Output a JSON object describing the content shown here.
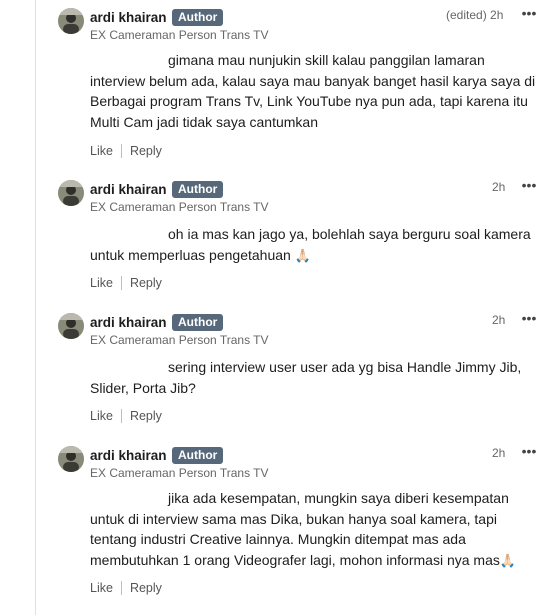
{
  "comments": [
    {
      "author": "ardi khairan",
      "badge": "Author",
      "subtitle": "EX Cameraman Person Trans TV",
      "time": "(edited) 2h",
      "text": "gimana mau nunjukin skill kalau panggilan lamaran interview belum ada, kalau saya mau banyak banget hasil karya saya di Berbagai program Trans Tv, Link YouTube nya pun ada, tapi karena itu Multi Cam jadi tidak saya cantumkan",
      "like": "Like",
      "reply": "Reply"
    },
    {
      "author": "ardi khairan",
      "badge": "Author",
      "subtitle": "EX Cameraman Person Trans TV",
      "time": "2h",
      "text": "oh ia mas kan jago ya, bolehlah saya berguru soal kamera untuk memperluas pengetahuan",
      "emoji": "🙏🏻",
      "like": "Like",
      "reply": "Reply"
    },
    {
      "author": "ardi khairan",
      "badge": "Author",
      "subtitle": "EX Cameraman Person Trans TV",
      "time": "2h",
      "text": "sering interview user user ada yg bisa Handle Jimmy Jib, Slider, Porta Jib?",
      "like": "Like",
      "reply": "Reply"
    },
    {
      "author": "ardi khairan",
      "badge": "Author",
      "subtitle": "EX Cameraman Person Trans TV",
      "time": "2h",
      "text": "jika ada kesempatan, mungkin saya diberi kesempatan untuk di interview sama mas Dika, bukan hanya soal kamera, tapi tentang industri Creative lainnya. Mungkin ditempat mas ada membutuhkan 1 orang Videografer lagi, mohon informasi nya mas",
      "emoji": "🙏🏻",
      "like": "Like",
      "reply": "Reply"
    }
  ],
  "icons": {
    "more": "more-horizontal-icon",
    "avatar": "user-avatar"
  },
  "colors": {
    "badge_bg": "#56687a",
    "badge_text": "#ffffff",
    "muted": "#666666"
  }
}
